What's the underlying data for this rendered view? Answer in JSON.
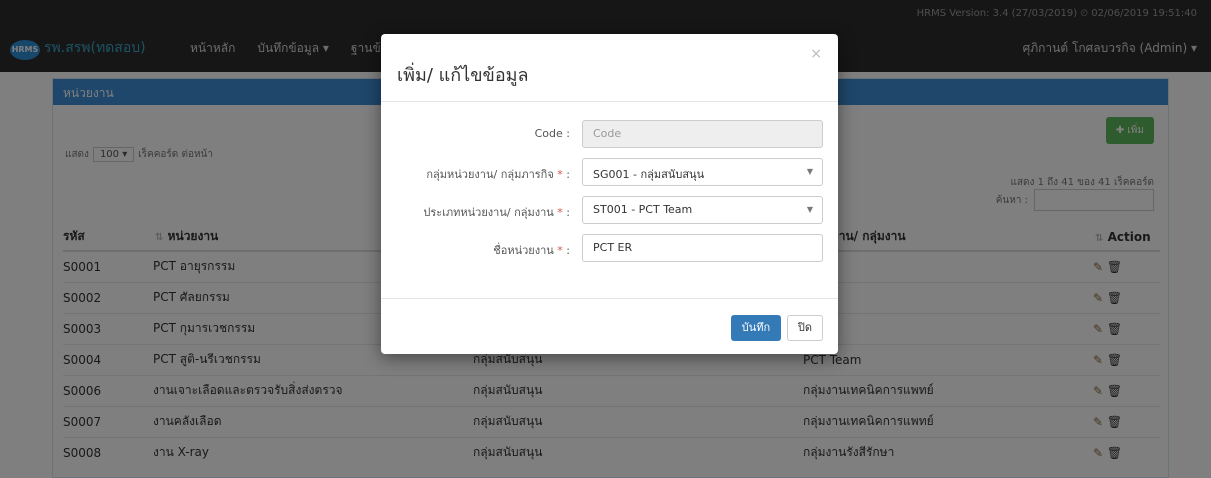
{
  "navbar": {
    "version": "HRMS Version: 3.4 (27/03/2019) ⏲ 02/06/2019 19:51:40",
    "logo": "HRMS",
    "brand": "รพ.สรพ(ทดสอบ)",
    "menu": [
      "หน้าหลัก",
      "บันทึกข้อมูล ▾",
      "ฐานข้อ"
    ],
    "user": "ศุภิกานต์ โกศลบวรกิจ (Admin) ▾"
  },
  "panel": {
    "heading": "หน่วยงาน",
    "show_prefix": "แสดง",
    "page_size": "100 ▾",
    "show_suffix": "เร็คคอร์ด ต่อหน้า",
    "add_button": "✚ เพิ่ม",
    "info": "แสดง 1 ถึง 41 ของ 41 เร็คคอร์ด",
    "search_label": "ค้นหา :"
  },
  "table": {
    "headers": [
      "รหัส",
      "หน่วยงาน",
      "",
      "หน่วยงาน/ กลุ่มงาน",
      "Action"
    ],
    "rows": [
      {
        "code": "S0001",
        "name": "PCT อายุรกรรม",
        "group": "",
        "type": "am"
      },
      {
        "code": "S0002",
        "name": "PCT ศัลยกรรม",
        "group": "",
        "type": "am"
      },
      {
        "code": "S0003",
        "name": "PCT กุมารเวชกรรม",
        "group": "",
        "type": "am"
      },
      {
        "code": "S0004",
        "name": "PCT สูติ-นรีเวชกรรม",
        "group": "กลุ่มสนับสนุน",
        "type": "PCT Team"
      },
      {
        "code": "S0006",
        "name": "งานเจาะเลือดและตรวจรับสิ่งส่งตรวจ",
        "group": "กลุ่มสนับสนุน",
        "type": "กลุ่มงานเทคนิคการแพทย์"
      },
      {
        "code": "S0007",
        "name": "งานคลังเลือด",
        "group": "กลุ่มสนับสนุน",
        "type": "กลุ่มงานเทคนิคการแพทย์"
      },
      {
        "code": "S0008",
        "name": "งาน X-ray",
        "group": "กลุ่มสนับสนุน",
        "type": "กลุ่มงานรังสีรักษา"
      }
    ],
    "edit_icon": "✎",
    "delete_icon": "🗑"
  },
  "modal": {
    "title": "เพิ่ม/ แก้ไขข้อมูล",
    "close": "×",
    "fields": {
      "code_label": "Code :",
      "code_placeholder": "Code",
      "group_label": "กลุ่มหน่วยงาน/ กลุ่มภารกิจ",
      "group_value": "SG001 - กลุ่มสนับสนุน",
      "type_label": "ประเภทหน่วยงาน/ กลุ่มงาน",
      "type_value": "ST001 - PCT Team",
      "name_label": "ชื่อหน่วยงาน",
      "name_value": "PCT ER",
      "required_mark": "*",
      "colon": " :"
    },
    "save_button": "บันทึก",
    "close_button": "ปิด"
  }
}
